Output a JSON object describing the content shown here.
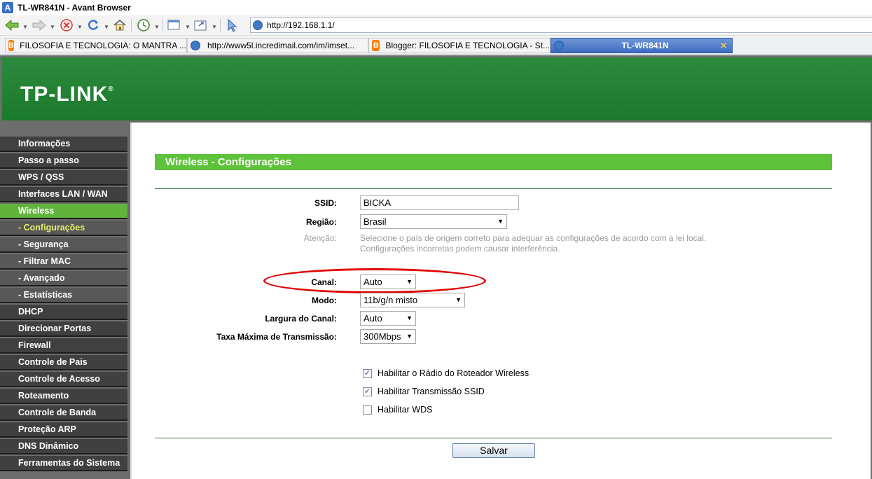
{
  "window": {
    "title": "TL-WR841N - Avant Browser"
  },
  "address_bar": {
    "url": "http://192.168.1.1/"
  },
  "tabs": [
    {
      "label": "FILOSOFIA E TECNOLOGIA: O MANTRA ...",
      "icon": "blogger-icon"
    },
    {
      "label": "http://www5l.incredimail.com/im/imset...",
      "icon": "ie-globe-icon"
    },
    {
      "label": "Blogger: FILOSOFIA E TECNOLOGIA - St...",
      "icon": "blogger-icon"
    },
    {
      "label": "TL-WR841N",
      "icon": "ie-globe-icon",
      "active": true
    }
  ],
  "brand": {
    "logo": "TP-LINK",
    "trademark": "®"
  },
  "sidebar": {
    "items": [
      {
        "label": "Informações"
      },
      {
        "label": "Passo a passo"
      },
      {
        "label": "WPS / QSS"
      },
      {
        "label": "Interfaces LAN / WAN"
      },
      {
        "label": "Wireless",
        "active": true
      },
      {
        "label": "- Configurações",
        "sub": true,
        "current": true
      },
      {
        "label": "- Segurança",
        "sub": true
      },
      {
        "label": "- Filtrar MAC",
        "sub": true
      },
      {
        "label": "- Avançado",
        "sub": true
      },
      {
        "label": "- Estatísticas",
        "sub": true
      },
      {
        "label": "DHCP"
      },
      {
        "label": "Direcionar Portas"
      },
      {
        "label": "Firewall"
      },
      {
        "label": "Controle de Pais"
      },
      {
        "label": "Controle de Acesso"
      },
      {
        "label": "Roteamento"
      },
      {
        "label": "Controle de Banda"
      },
      {
        "label": "Proteção ARP"
      },
      {
        "label": "DNS Dinâmico"
      },
      {
        "label": "Ferramentas do Sistema"
      }
    ]
  },
  "form": {
    "title": "Wireless - Configurações",
    "ssid": {
      "label": "SSID:",
      "value": "BICKA"
    },
    "regiao": {
      "label": "Região:",
      "value": "Brasil"
    },
    "atencao": {
      "label": "Atenção:",
      "line1": "Selecione o país de origem correto para adequar as configurações de acordo com a lei local.",
      "line2": "Configurações incorretas podem causar interferência."
    },
    "canal": {
      "label": "Canal:",
      "value": "Auto"
    },
    "modo": {
      "label": "Modo:",
      "value": "11b/g/n misto"
    },
    "largura": {
      "label": "Largura do Canal:",
      "value": "Auto"
    },
    "taxa": {
      "label": "Taxa Máxima de Transmissão:",
      "value": "300Mbps"
    },
    "checkboxes": [
      {
        "label": "Habilitar o Rádio do Roteador Wireless",
        "checked": true
      },
      {
        "label": "Habilitar Transmissão SSID",
        "checked": true
      },
      {
        "label": "Habilitar WDS",
        "checked": false
      }
    ],
    "save_label": "Salvar"
  },
  "colors": {
    "banner_green": "#238134",
    "section_green": "#5ec23a",
    "nav_active": "#60b43c",
    "nav_bg": "#404040",
    "highlight_red": "#e00000"
  }
}
